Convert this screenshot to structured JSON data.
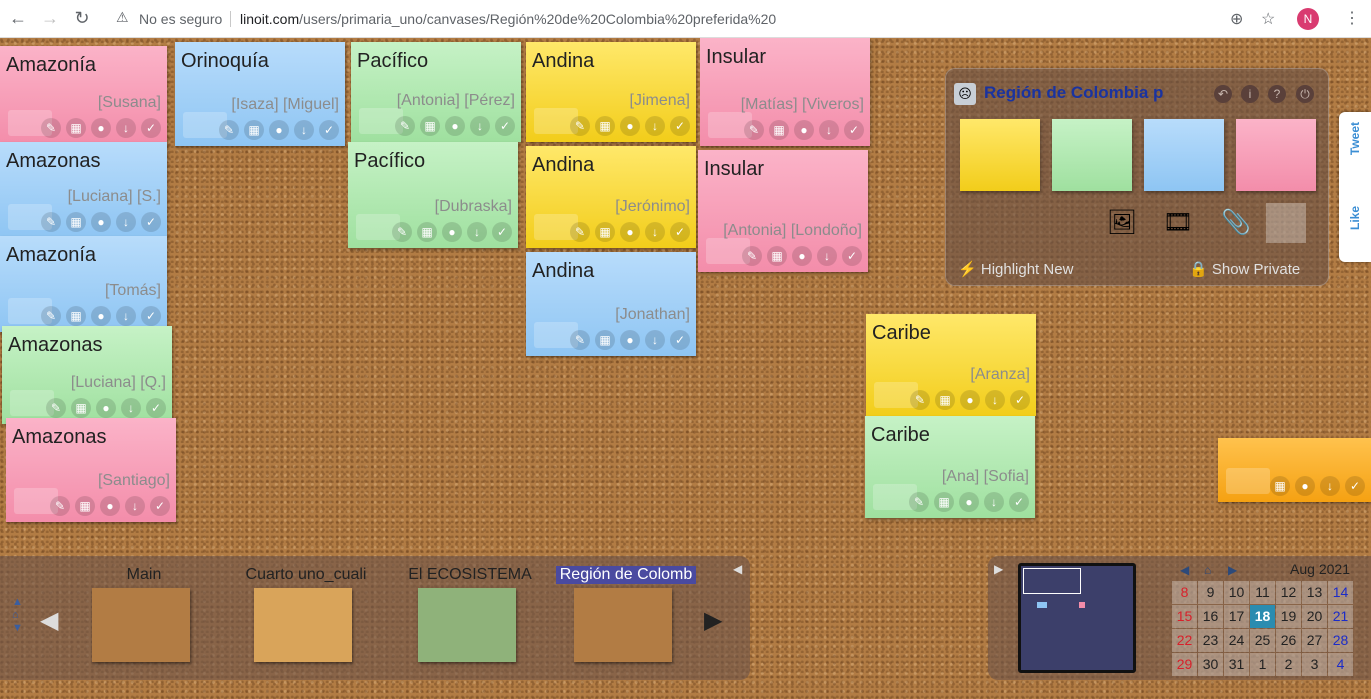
{
  "browser": {
    "security_label": "No es seguro",
    "url_domain": "linoit.com",
    "url_path": "/users/primaria_uno/canvases/Región%20de%20Colombia%20preferida%20",
    "profile_initial": "N"
  },
  "stickies": [
    {
      "title": "Amazonía",
      "author": "[Susana]",
      "color": "pink"
    },
    {
      "title": "Amazonas",
      "author": "[Luciana] [S.]",
      "color": "blue"
    },
    {
      "title": "Amazonía",
      "author": "[Tomás]",
      "color": "blue"
    },
    {
      "title": "Amazonas",
      "author": "[Luciana] [Q.]",
      "color": "green"
    },
    {
      "title": "Amazonas",
      "author": "[Santiago]",
      "color": "pink"
    },
    {
      "title": "Orinoquía",
      "author": "[Isaza] [Miguel]",
      "color": "blue"
    },
    {
      "title": "Pacífico",
      "author": "[Antonia] [Pérez]",
      "color": "green"
    },
    {
      "title": "Pacífico",
      "author": "[Dubraska]",
      "color": "green"
    },
    {
      "title": "Andina",
      "author": "[Jimena]",
      "color": "yellow"
    },
    {
      "title": "Andina",
      "author": "[Jerónimo]",
      "color": "yellow"
    },
    {
      "title": "Andina",
      "author": "[Jonathan]",
      "color": "blue"
    },
    {
      "title": "Insular",
      "author": "[Matías] [Viveros]",
      "color": "pink"
    },
    {
      "title": "Insular",
      "author": "[Antonia] [Londoño]",
      "color": "pink"
    },
    {
      "title": "Caribe",
      "author": "[Aranza]",
      "color": "yellow"
    },
    {
      "title": "Caribe",
      "author": "[Ana] [Sofia]",
      "color": "green"
    },
    {
      "title": "",
      "author": "",
      "color": "orange"
    }
  ],
  "panel": {
    "title": "Región de Colombia pre",
    "highlight_label": "Highlight New",
    "private_label": "Show Private",
    "swatches": [
      "yellow",
      "green",
      "blue",
      "pink"
    ]
  },
  "social": {
    "tweet": "Tweet",
    "like": "Like"
  },
  "canvases": [
    {
      "label": "Main",
      "selected": false
    },
    {
      "label": "Cuarto uno_cuali",
      "selected": false
    },
    {
      "label": "El ECOSISTEMA",
      "selected": false
    },
    {
      "label": "Región de Colomb",
      "selected": true
    }
  ],
  "calendar": {
    "month": "Aug 2021",
    "today": "18",
    "days": [
      "8",
      "9",
      "10",
      "11",
      "12",
      "13",
      "14",
      "15",
      "16",
      "17",
      "18",
      "19",
      "20",
      "21",
      "22",
      "23",
      "24",
      "25",
      "26",
      "27",
      "28",
      "29",
      "30",
      "31",
      "1",
      "2",
      "3",
      "4"
    ]
  }
}
